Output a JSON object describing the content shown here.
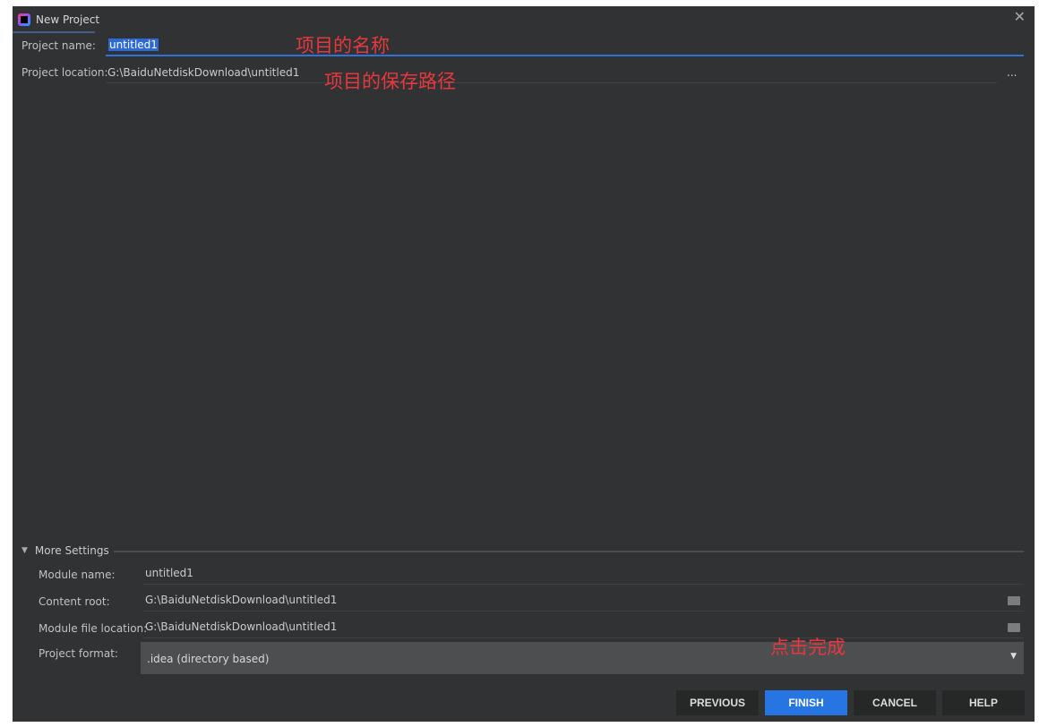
{
  "window": {
    "title": "New Project",
    "close_icon": "close-icon",
    "logo": "intellij-idea-logo"
  },
  "project": {
    "name_label": "Project name:",
    "name_value": "untitled1",
    "location_label": "Project location:",
    "location_value": "G:\\BaiduNetdiskDownload\\untitled1",
    "browse_label": "..."
  },
  "annotations": {
    "name": "项目的名称",
    "location": "项目的保存路径",
    "finish": "点击完成",
    "color": "#e8383d"
  },
  "more_settings": {
    "title": "More Settings",
    "module_name_label": "Module name:",
    "module_name_value": "untitled1",
    "content_root_label": "Content root:",
    "content_root_value": "G:\\BaiduNetdiskDownload\\untitled1",
    "module_file_label": "Module file location:",
    "module_file_value": "G:\\BaiduNetdiskDownload\\untitled1",
    "format_label": "Project format:",
    "format_value": ".idea (directory based)"
  },
  "buttons": {
    "previous": "PREVIOUS",
    "finish": "FINISH",
    "cancel": "CANCEL",
    "help": "HELP"
  },
  "colors": {
    "accent": "#2675e3",
    "background": "#313233"
  }
}
